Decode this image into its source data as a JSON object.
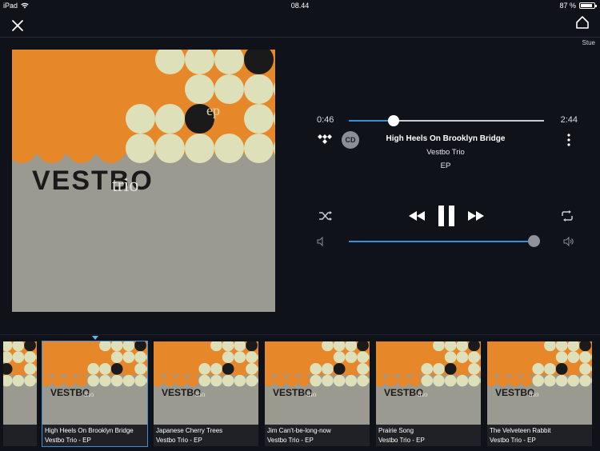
{
  "status_bar": {
    "device": "iPad",
    "time": "08.44",
    "battery": "87 %",
    "battery_level": 0.87
  },
  "header": {
    "room": "Stue"
  },
  "now_playing": {
    "elapsed": "0:46",
    "duration": "2:44",
    "progress": 0.23,
    "title": "High Heels On Brooklyn Bridge",
    "artist": "Vestbo Trio",
    "album": "EP",
    "source_icon": "tidal-icon",
    "quality_badge": "CD",
    "volume": 0.97
  },
  "album_art": {
    "band": "VESTBO",
    "suffix": "trio",
    "tag": "ep"
  },
  "queue": [
    {
      "title": "High Heels On Brooklyn Bridge",
      "subtitle": "Vestbo Trio - EP",
      "current": true
    },
    {
      "title": "Japanese Cherry Trees",
      "subtitle": "Vestbo Trio - EP",
      "current": false
    },
    {
      "title": "Jim Can't-be-long-now",
      "subtitle": "Vestbo Trio - EP",
      "current": false
    },
    {
      "title": "Prairie Song",
      "subtitle": "Vestbo Trio - EP",
      "current": false
    },
    {
      "title": "The Velveteen Rabbit",
      "subtitle": "Vestbo Trio - EP",
      "current": false
    }
  ],
  "colors": {
    "background": "#0f1219",
    "accent": "#3a8fd6",
    "album_orange": "#e6882a",
    "album_cream": "#dde0b8",
    "album_grey": "#9a9a90"
  }
}
